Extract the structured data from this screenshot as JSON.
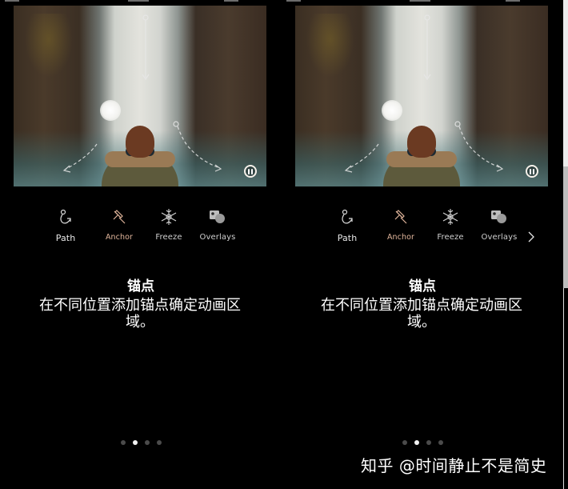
{
  "screens": [
    {
      "id": "left",
      "tools": [
        {
          "key": "path",
          "label": "Path",
          "icon": "path-icon",
          "active": false
        },
        {
          "key": "anchor",
          "label": "Anchor",
          "icon": "anchor-pin-icon",
          "active": true
        },
        {
          "key": "freeze",
          "label": "Freeze",
          "icon": "snowflake-icon",
          "active": false
        },
        {
          "key": "overlays",
          "label": "Overlays",
          "icon": "overlays-icon",
          "active": false
        }
      ],
      "title": "锚点",
      "description": "在不同位置添加锚点确定动画区域。",
      "page_indicator": {
        "total": 4,
        "current": 2
      },
      "video_state": "playing",
      "pause_icon": "pause-icon"
    },
    {
      "id": "right",
      "tools": [
        {
          "key": "path",
          "label": "Path",
          "icon": "path-icon",
          "active": false
        },
        {
          "key": "anchor",
          "label": "Anchor",
          "icon": "anchor-pin-icon",
          "active": true
        },
        {
          "key": "freeze",
          "label": "Freeze",
          "icon": "snowflake-icon",
          "active": false
        },
        {
          "key": "overlays",
          "label": "Overlays",
          "icon": "overlays-icon",
          "active": false
        }
      ],
      "more_icon": "chevron-right-icon",
      "title": "锚点",
      "description": "在不同位置添加锚点确定动画区域。",
      "page_indicator": {
        "total": 4,
        "current": 2
      },
      "video_state": "playing",
      "pause_icon": "pause-icon"
    }
  ],
  "watermark": "知乎 @时间静止不是简史",
  "colors": {
    "background": "#000000",
    "active_accent": "#e0b59b",
    "inactive_label": "#cfcfcf",
    "dot_active": "#f2f2f2",
    "dot_inactive": "#4b4b4b"
  }
}
